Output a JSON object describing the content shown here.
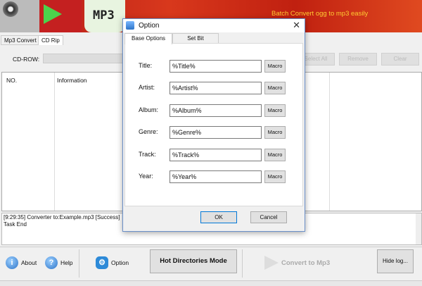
{
  "banner": {
    "slogan": "Batch Convert  ogg to mp3 easily",
    "logo_text": "MP3"
  },
  "tabs": [
    {
      "label": "Mp3 Convert"
    },
    {
      "label": "CD Rip"
    }
  ],
  "cd": {
    "label": "CD-ROW:",
    "buttons": [
      "Select All",
      "Remove",
      "Clear"
    ]
  },
  "list": {
    "columns": [
      "NO.",
      "Information"
    ]
  },
  "log": {
    "lines": [
      "[9:29:35] Converter to:Example.mp3 [Success]",
      "Task End"
    ]
  },
  "toolbar": {
    "about": "About",
    "help": "Help",
    "option": "Option",
    "hot": "Hot Directories Mode",
    "convert": "Convert to Mp3",
    "hidelog": "Hide log..."
  },
  "dialog": {
    "title": "Option",
    "tabs": [
      "Base Options",
      "Set Bit"
    ],
    "fields": [
      {
        "label": "Title:",
        "value": "%Title%"
      },
      {
        "label": "Artist:",
        "value": "%Artist%"
      },
      {
        "label": "Album:",
        "value": "%Album%"
      },
      {
        "label": "Genre:",
        "value": "%Genre%"
      },
      {
        "label": "Track:",
        "value": "%Track%"
      },
      {
        "label": "Year:",
        "value": "%Year%"
      }
    ],
    "macro": "Macro",
    "ok": "OK",
    "cancel": "Cancel"
  }
}
